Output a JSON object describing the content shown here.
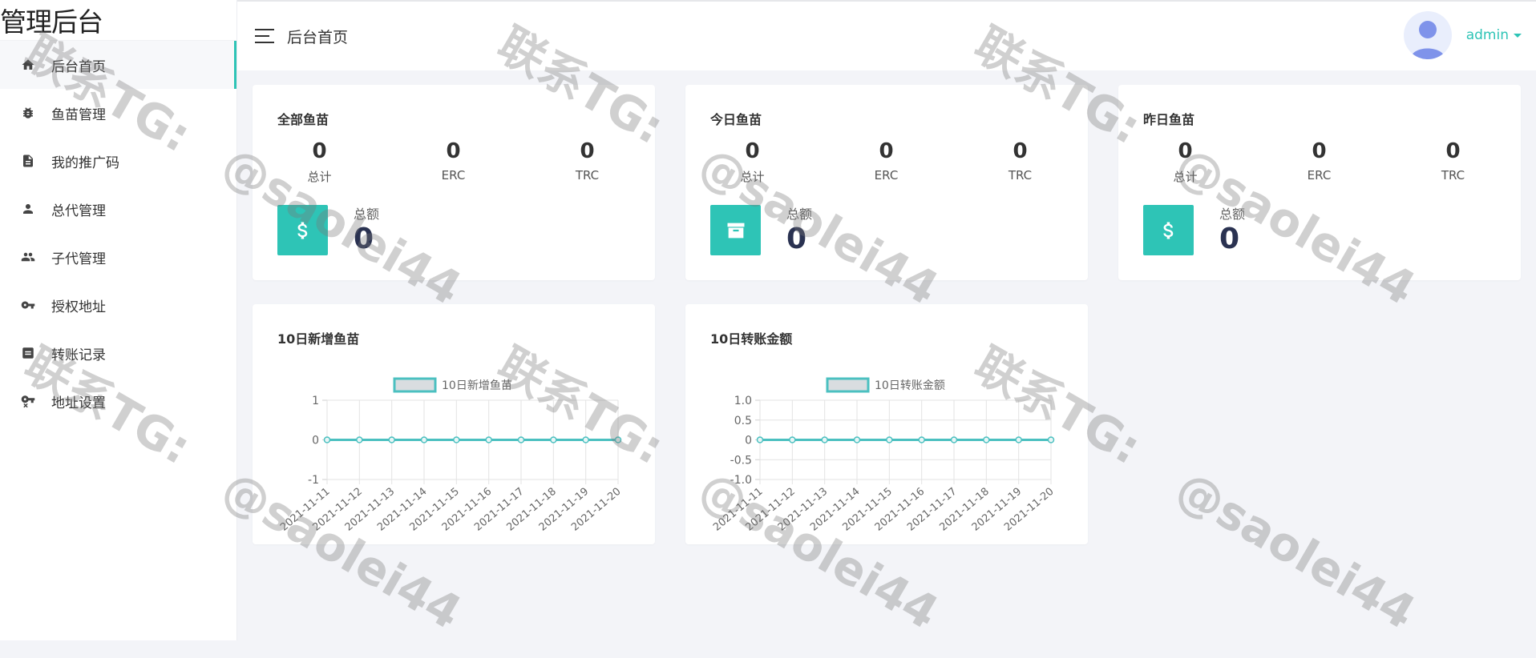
{
  "app": {
    "brand": "管理后台"
  },
  "header": {
    "title": "后台首页",
    "username": "admin"
  },
  "sidebar": {
    "items": [
      {
        "label": "后台首页",
        "icon": "home-icon",
        "active": true
      },
      {
        "label": "鱼苗管理",
        "icon": "bug-icon",
        "active": false
      },
      {
        "label": "我的推广码",
        "icon": "document-icon",
        "active": false
      },
      {
        "label": "总代管理",
        "icon": "user-icon",
        "active": false
      },
      {
        "label": "子代管理",
        "icon": "users-icon",
        "active": false
      },
      {
        "label": "授权地址",
        "icon": "key-icon",
        "active": false
      },
      {
        "label": "转账记录",
        "icon": "list-icon",
        "active": false
      },
      {
        "label": "地址设置",
        "icon": "key-remove-icon",
        "active": false
      }
    ]
  },
  "cards": [
    {
      "title": "全部鱼苗",
      "stats": [
        {
          "value": "0",
          "label": "总计"
        },
        {
          "value": "0",
          "label": "ERC"
        },
        {
          "value": "0",
          "label": "TRC"
        }
      ],
      "total_label": "总额",
      "total_value": "0",
      "icon": "dollar-icon"
    },
    {
      "title": "今日鱼苗",
      "stats": [
        {
          "value": "0",
          "label": "总计"
        },
        {
          "value": "0",
          "label": "ERC"
        },
        {
          "value": "0",
          "label": "TRC"
        }
      ],
      "total_label": "总额",
      "total_value": "0",
      "icon": "archive-icon"
    },
    {
      "title": "昨日鱼苗",
      "stats": [
        {
          "value": "0",
          "label": "总计"
        },
        {
          "value": "0",
          "label": "ERC"
        },
        {
          "value": "0",
          "label": "TRC"
        }
      ],
      "total_label": "总额",
      "total_value": "0",
      "icon": "dollar-icon"
    }
  ],
  "chart_panels": [
    {
      "title": "10日新增鱼苗"
    },
    {
      "title": "10日转账金额"
    }
  ],
  "chart_data": [
    {
      "type": "line",
      "legend": [
        "10日新增鱼苗"
      ],
      "x": [
        "2021-11-11",
        "2021-11-12",
        "2021-11-13",
        "2021-11-14",
        "2021-11-15",
        "2021-11-16",
        "2021-11-17",
        "2021-11-18",
        "2021-11-19",
        "2021-11-20"
      ],
      "series": [
        {
          "name": "10日新增鱼苗",
          "values": [
            0,
            0,
            0,
            0,
            0,
            0,
            0,
            0,
            0,
            0
          ]
        }
      ],
      "yticks": [
        "1",
        "0",
        "-1"
      ],
      "ylim": [
        -1,
        1
      ],
      "grid": true,
      "legend_position": "top"
    },
    {
      "type": "line",
      "legend": [
        "10日转账金额"
      ],
      "x": [
        "2021-11-11",
        "2021-11-12",
        "2021-11-13",
        "2021-11-14",
        "2021-11-15",
        "2021-11-16",
        "2021-11-17",
        "2021-11-18",
        "2021-11-19",
        "2021-11-20"
      ],
      "series": [
        {
          "name": "10日转账金额",
          "values": [
            0,
            0,
            0,
            0,
            0,
            0,
            0,
            0,
            0,
            0
          ]
        }
      ],
      "yticks": [
        "1.0",
        "0.5",
        "0",
        "-0.5",
        "-1.0"
      ],
      "ylim": [
        -1,
        1
      ],
      "grid": true,
      "legend_position": "top"
    }
  ],
  "colors": {
    "accent": "#2ec4b6",
    "line": "#4bc0c0",
    "legend_fill": "#d9dde0"
  },
  "watermark": {
    "line1": "联系TG:",
    "line2": "@saolei44"
  }
}
